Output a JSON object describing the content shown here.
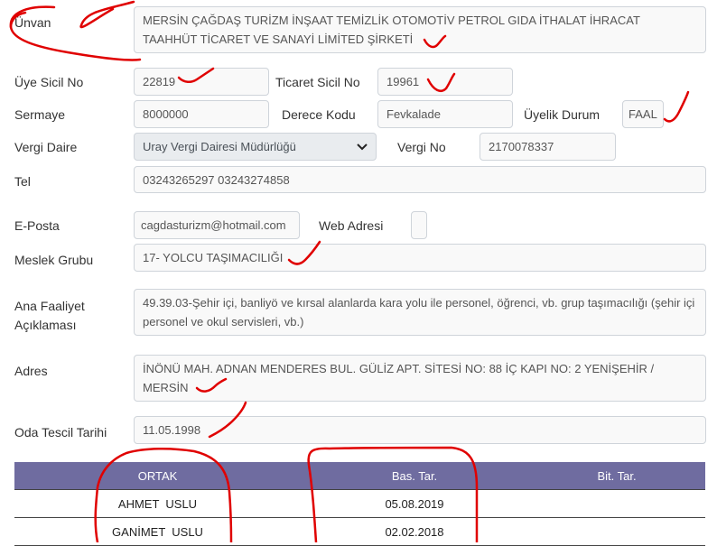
{
  "form": {
    "unvan_label": "Ünvan",
    "unvan_value": "MERSİN ÇAĞDAŞ TURİZM İNŞAAT TEMİZLİK OTOMOTİV PETROL GIDA İTHALAT İHRACAT TAAHHÜT TİCARET VE SANAYİ LİMİTED ŞİRKETİ",
    "uye_sicil_label": "Üye Sicil No",
    "uye_sicil_value": "22819",
    "ticaret_sicil_label": "Ticaret Sicil No",
    "ticaret_sicil_value": "19961",
    "sermaye_label": "Sermaye",
    "sermaye_value": "8000000",
    "derece_label": "Derece Kodu",
    "derece_value": "Fevkalade",
    "uyelik_label": "Üyelik Durum",
    "uyelik_value": "FAAL",
    "vergi_daire_label": "Vergi Daire",
    "vergi_daire_value": "Uray Vergi Dairesi Müdürlüğü",
    "vergi_no_label": "Vergi No",
    "vergi_no_value": "2170078337",
    "tel_label": "Tel",
    "tel_value": "03243265297 03243274858",
    "eposta_label": "E-Posta",
    "eposta_value": "cagdasturizm@hotmail.com",
    "web_label": "Web Adresi",
    "web_value": "",
    "meslek_label": "Meslek Grubu",
    "meslek_value": "17- YOLCU TAŞIMACILIĞI",
    "faaliyet_label_1": "Ana Faaliyet",
    "faaliyet_label_2": "Açıklaması",
    "faaliyet_value": "49.39.03-Şehir içi, banliyö ve kırsal alanlarda kara yolu ile personel, öğrenci, vb. grup taşımacılığı (şehir içi personel ve okul servisleri, vb.)",
    "adres_label": "Adres",
    "adres_value": "İNÖNÜ MAH. ADNAN MENDERES BUL. GÜLİZ APT. SİTESİ NO: 88 İÇ KAPI NO: 2 YENİŞEHİR / MERSİN",
    "tescil_label": "Oda Tescil Tarihi",
    "tescil_value": "11.05.1998"
  },
  "partners_table": {
    "headers": [
      "ORTAK",
      "Bas. Tar.",
      "Bit. Tar."
    ],
    "rows": [
      [
        "AHMET  USLU",
        "05.08.2019",
        ""
      ],
      [
        "GANİMET  USLU",
        "02.02.2018",
        ""
      ]
    ]
  },
  "colors": {
    "header_bg": "#6f6ca0",
    "annotation_ink": "#e00000"
  },
  "icons": {
    "select_arrow": "chevron-down-icon"
  }
}
